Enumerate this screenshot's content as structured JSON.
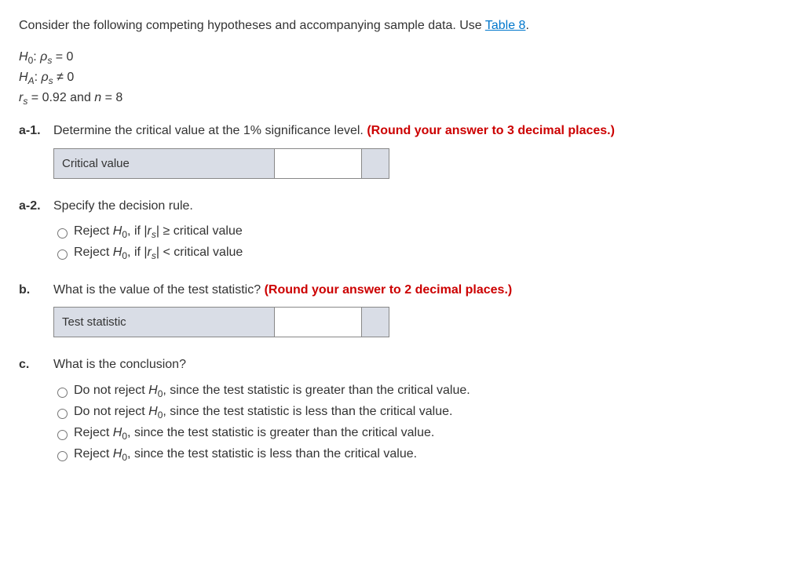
{
  "intro": {
    "prefix": "Consider the following competing hypotheses and accompanying sample data. Use ",
    "link": "Table 8",
    "suffix": "."
  },
  "hypotheses": {
    "h0": "= 0",
    "ha": "≠ 0",
    "rs_label": "= 0.92 and ",
    "n_label": "= 8"
  },
  "a1": {
    "label": "a-1.",
    "text": "Determine the critical value at the 1% significance level. ",
    "red": "(Round your answer to 3 decimal places.)",
    "box_label": "Critical value"
  },
  "a2": {
    "label": "a-2.",
    "text": "Specify the decision rule.",
    "opt1_suffix": "≥ critical value",
    "opt2_suffix": "< critical value"
  },
  "b": {
    "label": "b.",
    "text": "What is the value of the test statistic? ",
    "red": "(Round your answer to 2 decimal places.)",
    "box_label": "Test statistic"
  },
  "c": {
    "label": "c.",
    "text": "What is the conclusion?",
    "opt1_suffix": ", since the test statistic is greater than the critical value.",
    "opt2_suffix": ", since the test statistic is less than the critical value.",
    "opt3_suffix": ", since the test statistic is greater than the critical value.",
    "opt4_suffix": ", since the test statistic is less than the critical value."
  }
}
